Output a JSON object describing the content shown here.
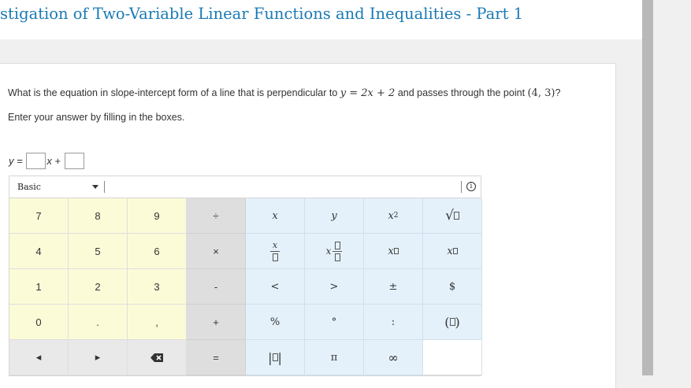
{
  "header": {
    "title": "stigation of Two-Variable Linear Functions and Inequalities - Part 1"
  },
  "question": {
    "prefix": "What is the equation in slope-intercept form of a line that is perpendicular to",
    "equation": "y = 2x + 2",
    "middle": "and passes through the point",
    "point": "(4, 3)",
    "suffix": "?",
    "instruction": "Enter your answer by filling in the boxes."
  },
  "answer": {
    "lhs": "y =",
    "var": "x",
    "plus": "+",
    "slope_value": "",
    "intercept_value": ""
  },
  "keypad": {
    "mode": "Basic",
    "info_symbol": "i",
    "digits": {
      "seven": "7",
      "eight": "8",
      "nine": "9",
      "four": "4",
      "five": "5",
      "six": "6",
      "one": "1",
      "two": "2",
      "three": "3",
      "zero": "0",
      "dot": ".",
      "comma": ","
    },
    "ops": {
      "divide": "÷",
      "times": "×",
      "minus": "-",
      "plus": "+",
      "equals": "="
    },
    "fn": {
      "x": "x",
      "y": "y",
      "x_sq_base": "x",
      "x_sq_exp": "2",
      "sqrt": "√",
      "x_frac_top": "x",
      "x_over": "x",
      "x_pow": "x",
      "x_sub": "x",
      "lt": "<",
      "gt": ">",
      "pm": "±",
      "dollar": "$",
      "percent": "%",
      "degree": "°",
      "colon": ":",
      "paren_l": "(",
      "paren_r": ")",
      "abs": "|",
      "pi": "π",
      "infinity": "∞"
    },
    "nav": {
      "left": "◂",
      "right": "▸"
    }
  }
}
